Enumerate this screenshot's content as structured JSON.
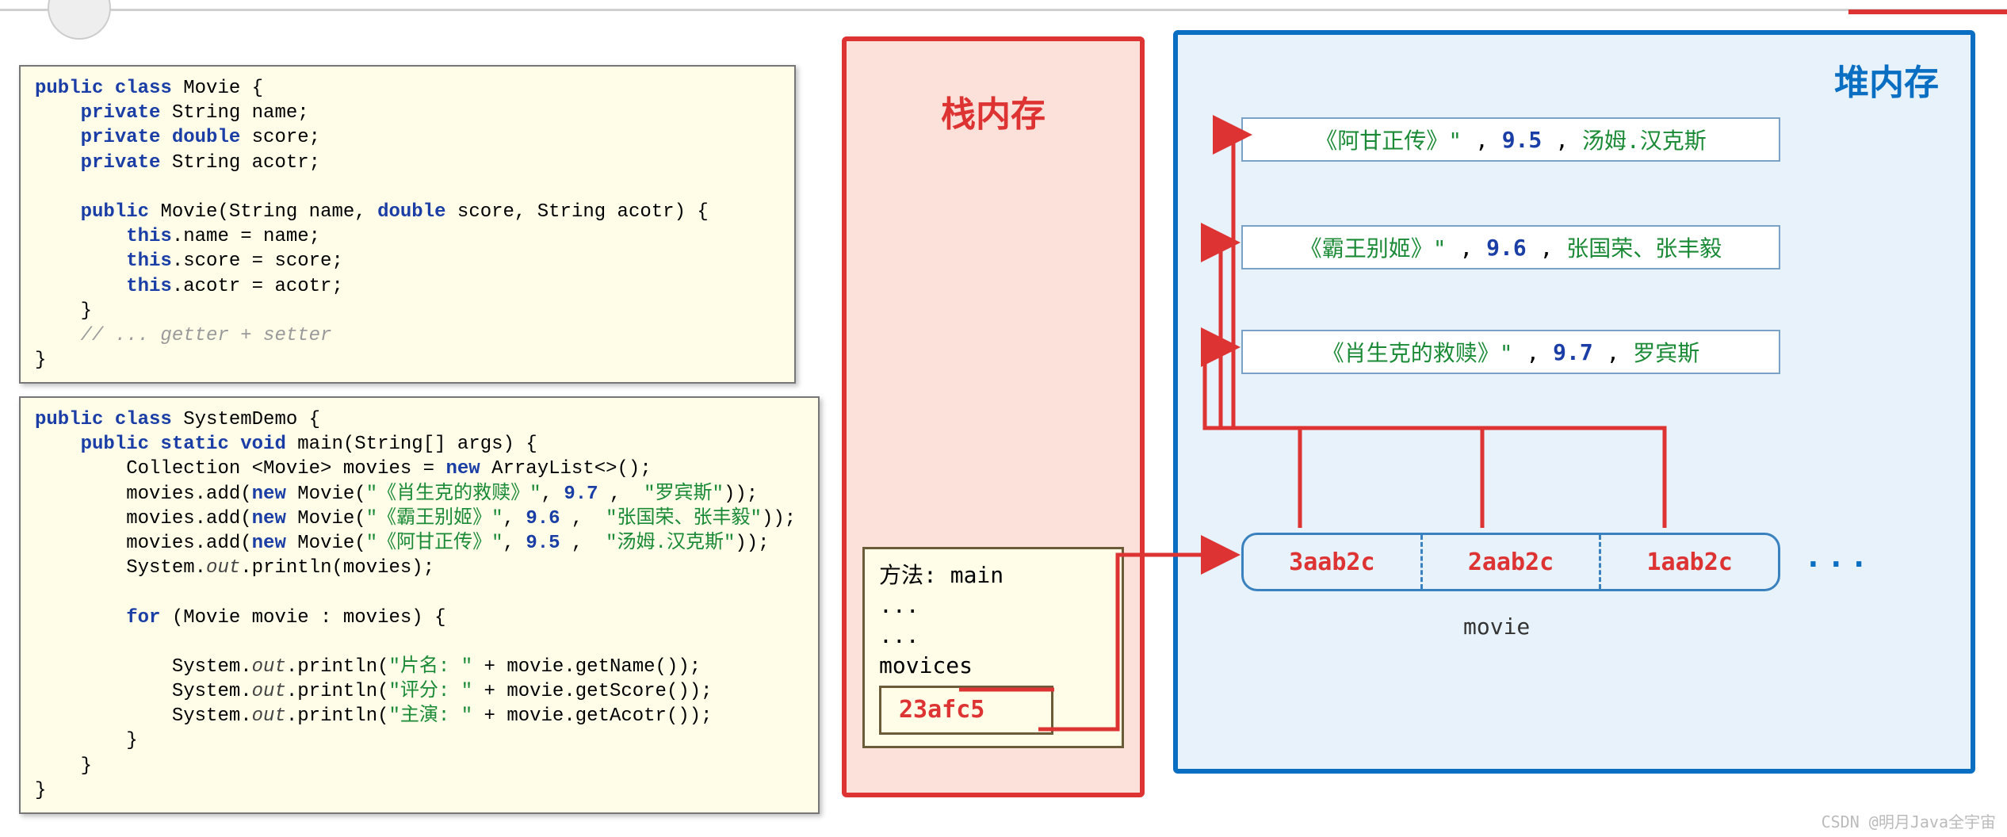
{
  "code1": {
    "lines": [
      [
        {
          "t": "public class ",
          "c": "kw"
        },
        {
          "t": "Movie {",
          "c": ""
        }
      ],
      [
        {
          "t": "    private ",
          "c": "kw"
        },
        {
          "t": "String name;",
          "c": ""
        }
      ],
      [
        {
          "t": "    private double ",
          "c": "kw"
        },
        {
          "t": "score;",
          "c": ""
        }
      ],
      [
        {
          "t": "    private ",
          "c": "kw"
        },
        {
          "t": "String acotr;",
          "c": ""
        }
      ],
      [
        {
          "t": "",
          "c": ""
        }
      ],
      [
        {
          "t": "    public ",
          "c": "kw"
        },
        {
          "t": "Movie(String name, ",
          "c": ""
        },
        {
          "t": "double",
          "c": "kw"
        },
        {
          "t": " score, String acotr) {",
          "c": ""
        }
      ],
      [
        {
          "t": "        this",
          "c": "kw"
        },
        {
          "t": ".name = name;",
          "c": ""
        }
      ],
      [
        {
          "t": "        this",
          "c": "kw"
        },
        {
          "t": ".score = score;",
          "c": ""
        }
      ],
      [
        {
          "t": "        this",
          "c": "kw"
        },
        {
          "t": ".acotr = acotr;",
          "c": ""
        }
      ],
      [
        {
          "t": "    }",
          "c": ""
        }
      ],
      [
        {
          "t": "    // ... getter + setter",
          "c": "cmt"
        }
      ],
      [
        {
          "t": "}",
          "c": ""
        }
      ]
    ]
  },
  "code2": {
    "lines": [
      [
        {
          "t": "public class ",
          "c": "kw"
        },
        {
          "t": "SystemDemo {",
          "c": ""
        }
      ],
      [
        {
          "t": "    public static void ",
          "c": "kw"
        },
        {
          "t": "main(String[] args) {",
          "c": ""
        }
      ],
      [
        {
          "t": "        Collection <Movie> movies = ",
          "c": ""
        },
        {
          "t": "new ",
          "c": "kw"
        },
        {
          "t": "ArrayList<>();",
          "c": ""
        }
      ],
      [
        {
          "t": "        movies.add(",
          "c": ""
        },
        {
          "t": "new ",
          "c": "kw"
        },
        {
          "t": "Movie(",
          "c": ""
        },
        {
          "t": "\"《肖生克的救赎》\"",
          "c": "str"
        },
        {
          "t": ", ",
          "c": ""
        },
        {
          "t": "9.7",
          "c": "num"
        },
        {
          "t": " ,  ",
          "c": ""
        },
        {
          "t": "\"罗宾斯\"",
          "c": "str"
        },
        {
          "t": "));",
          "c": ""
        }
      ],
      [
        {
          "t": "        movies.add(",
          "c": ""
        },
        {
          "t": "new ",
          "c": "kw"
        },
        {
          "t": "Movie(",
          "c": ""
        },
        {
          "t": "\"《霸王别姬》\"",
          "c": "str"
        },
        {
          "t": ", ",
          "c": ""
        },
        {
          "t": "9.6",
          "c": "num"
        },
        {
          "t": " ,  ",
          "c": ""
        },
        {
          "t": "\"张国荣、张丰毅\"",
          "c": "str"
        },
        {
          "t": "));",
          "c": ""
        }
      ],
      [
        {
          "t": "        movies.add(",
          "c": ""
        },
        {
          "t": "new ",
          "c": "kw"
        },
        {
          "t": "Movie(",
          "c": ""
        },
        {
          "t": "\"《阿甘正传》\"",
          "c": "str"
        },
        {
          "t": ", ",
          "c": ""
        },
        {
          "t": "9.5",
          "c": "num"
        },
        {
          "t": " ,  ",
          "c": ""
        },
        {
          "t": "\"汤姆.汉克斯\"",
          "c": "str"
        },
        {
          "t": "));",
          "c": ""
        }
      ],
      [
        {
          "t": "        System.",
          "c": ""
        },
        {
          "t": "out",
          "c": "fld"
        },
        {
          "t": ".println(movies);",
          "c": ""
        }
      ],
      [
        {
          "t": "",
          "c": ""
        }
      ],
      [
        {
          "t": "        for ",
          "c": "kw"
        },
        {
          "t": "(Movie movie : movies) {",
          "c": ""
        }
      ],
      [
        {
          "t": "",
          "c": ""
        }
      ],
      [
        {
          "t": "            System.",
          "c": ""
        },
        {
          "t": "out",
          "c": "fld"
        },
        {
          "t": ".println(",
          "c": ""
        },
        {
          "t": "\"片名: \"",
          "c": "str"
        },
        {
          "t": " + movie.getName());",
          "c": ""
        }
      ],
      [
        {
          "t": "            System.",
          "c": ""
        },
        {
          "t": "out",
          "c": "fld"
        },
        {
          "t": ".println(",
          "c": ""
        },
        {
          "t": "\"评分: \"",
          "c": "str"
        },
        {
          "t": " + movie.getScore());",
          "c": ""
        }
      ],
      [
        {
          "t": "            System.",
          "c": ""
        },
        {
          "t": "out",
          "c": "fld"
        },
        {
          "t": ".println(",
          "c": ""
        },
        {
          "t": "\"主演: \"",
          "c": "str"
        },
        {
          "t": " + movie.getAcotr());",
          "c": ""
        }
      ],
      [
        {
          "t": "        }",
          "c": ""
        }
      ],
      [
        {
          "t": "    }",
          "c": ""
        }
      ],
      [
        {
          "t": "}",
          "c": ""
        }
      ]
    ]
  },
  "stack": {
    "title": "栈内存",
    "frame": {
      "line1": "方法: main",
      "line2": "...",
      "line3": "...",
      "var": "movices",
      "addr": "23afc5"
    }
  },
  "heap": {
    "title": "堆内存",
    "objects": [
      {
        "name": "《阿甘正传》\"",
        "score": "9.5",
        "actor": "汤姆.汉克斯"
      },
      {
        "name": "《霸王别姬》\"",
        "score": "9.6",
        "actor": "张国荣、张丰毅"
      },
      {
        "name": "《肖生克的救赎》\"",
        "score": "9.7",
        "actor": "罗宾斯"
      }
    ],
    "array": {
      "cells": [
        "3aab2c",
        "2aab2c",
        "1aab2c"
      ],
      "more": "...",
      "label": "movie"
    }
  },
  "watermark": "CSDN @明月Java全宇宙"
}
